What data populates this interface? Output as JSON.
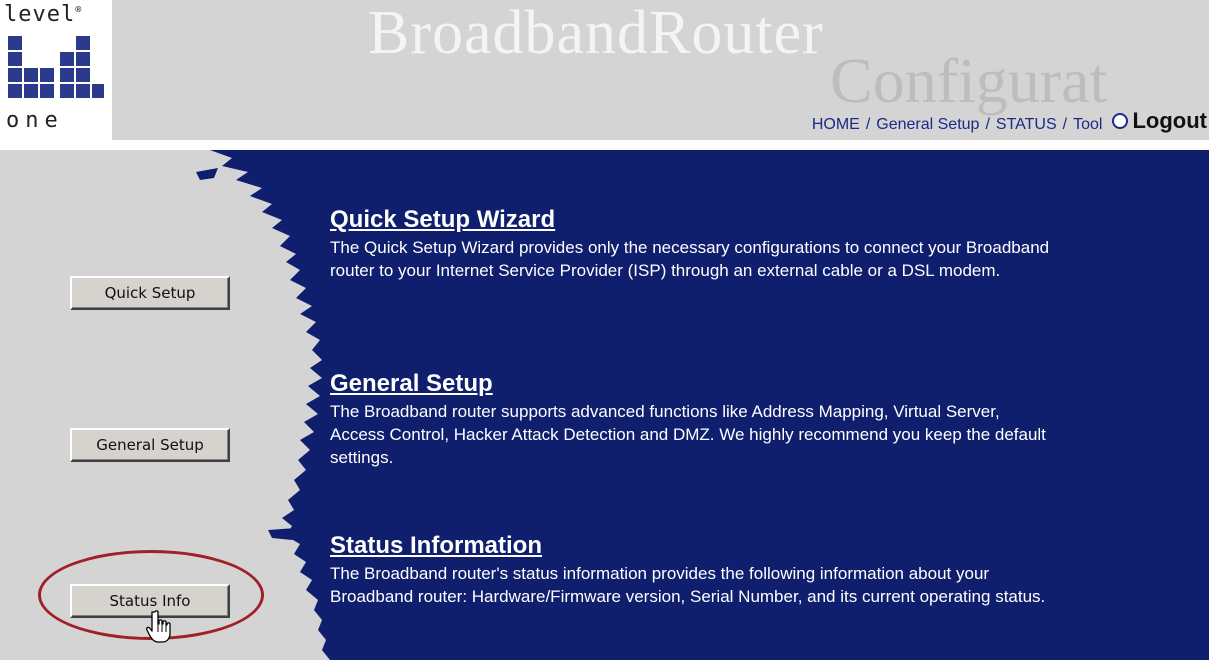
{
  "logo": {
    "top_text": "level",
    "top_mark": "®",
    "bottom_text": "one"
  },
  "header": {
    "title": "BroadbandRouter",
    "ghost_title": "Configurat"
  },
  "topnav": {
    "home": "HOME",
    "general_setup": "General Setup",
    "status": "STATUS",
    "tool": "Tool",
    "separator": "/",
    "logout": "Logout"
  },
  "buttons": {
    "quick_setup": "Quick Setup",
    "general_setup": "General Setup",
    "status_info": "Status Info"
  },
  "sections": [
    {
      "title": "Quick Setup Wizard",
      "description": "The Quick Setup Wizard provides only the necessary configurations to connect your Broadband router to your Internet Service Provider (ISP) through an external cable or a DSL modem."
    },
    {
      "title": "General Setup",
      "description": "The Broadband router supports advanced functions like Address Mapping, Virtual Server, Access Control, Hacker Attack Detection and DMZ. We highly recommend you keep the default settings."
    },
    {
      "title": "Status Information",
      "description": "The Broadband router's status information provides the following information about your Broadband router: Hardware/Firmware version, Serial Number, and its current operating status."
    }
  ],
  "colors": {
    "panel_blue": "#0f1f6e",
    "header_gray": "#d4d4d4",
    "link_blue": "#1a2a88",
    "highlight_red": "#a0202a",
    "logo_blue": "#2b3a8c"
  }
}
